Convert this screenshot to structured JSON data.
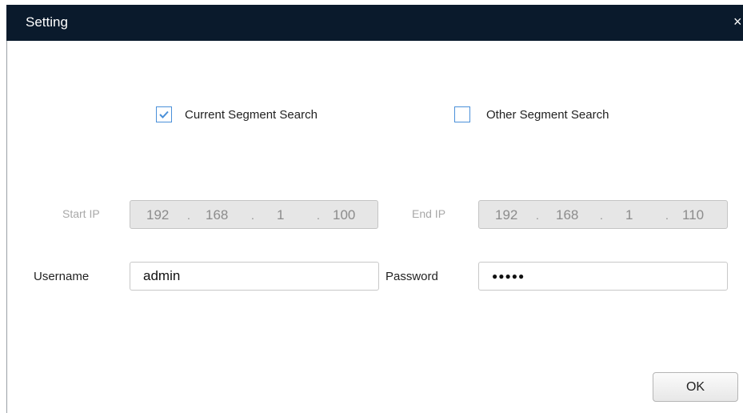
{
  "window": {
    "title": "Setting",
    "close_glyph": "×"
  },
  "search_mode": {
    "current": {
      "label": "Current Segment Search",
      "checked": true
    },
    "other": {
      "label": "Other Segment Search",
      "checked": false
    }
  },
  "ip_range": {
    "start_label": "Start IP",
    "start": [
      "192",
      "168",
      "1",
      "100"
    ],
    "end_label": "End IP",
    "end": [
      "192",
      "168",
      "1",
      "110"
    ]
  },
  "credentials": {
    "username_label": "Username",
    "username_value": "admin",
    "password_label": "Password",
    "password_masked": "●●●●●"
  },
  "actions": {
    "ok_label": "OK"
  },
  "colors": {
    "titlebar": "#0a1a2c",
    "checkbox_accent": "#4a90d9",
    "disabled_field": "#e6e6e6"
  }
}
